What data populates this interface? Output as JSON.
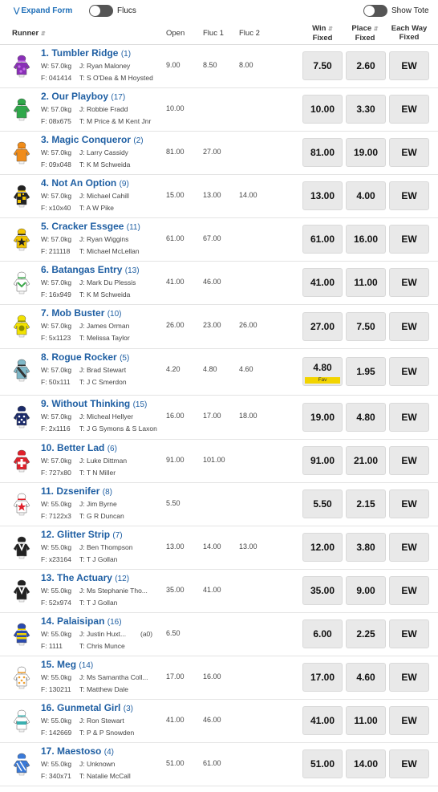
{
  "topbar": {
    "expand_label": "Expand Form",
    "flucs_label": "Flucs",
    "tote_label": "Show Tote"
  },
  "header": {
    "runner": "Runner",
    "open": "Open",
    "fluc1": "Fluc 1",
    "fluc2": "Fluc 2",
    "win": [
      "Win",
      "Fixed"
    ],
    "place": [
      "Place",
      "Fixed"
    ],
    "ew": [
      "Each Way",
      "Fixed"
    ]
  },
  "runners": [
    {
      "num": "1.",
      "name": "Tumbler Ridge",
      "barrier": "(1)",
      "weight": "W: 57.0kg",
      "jockey": "J: Ryan Maloney",
      "extra": "",
      "form": "F: 041414",
      "trainer": "T: S O'Dea & M Hoysted",
      "open": "9.00",
      "fluc1": "8.50",
      "fluc2": "8.00",
      "win": "7.50",
      "place": "2.60",
      "ew": "EW",
      "fav": "",
      "silk": {
        "a": "#8a2fb8",
        "b": "#c56ee8",
        "pattern": "stars"
      }
    },
    {
      "num": "2.",
      "name": "Our Playboy",
      "barrier": "(17)",
      "weight": "W: 57.0kg",
      "jockey": "J: Robbie Fradd",
      "extra": "",
      "form": "F: 08x675",
      "trainer": "T: M Price & M Kent Jnr",
      "open": "10.00",
      "fluc1": "",
      "fluc2": "",
      "win": "10.00",
      "place": "3.30",
      "ew": "EW",
      "fav": "",
      "silk": {
        "a": "#2fa84a",
        "b": "#1f7a33",
        "pattern": "plain"
      }
    },
    {
      "num": "3.",
      "name": "Magic Conqueror",
      "barrier": "(2)",
      "weight": "W: 57.0kg",
      "jockey": "J: Larry Cassidy",
      "extra": "",
      "form": "F: 09x048",
      "trainer": "T: K M Schweida",
      "open": "81.00",
      "fluc1": "27.00",
      "fluc2": "",
      "win": "81.00",
      "place": "19.00",
      "ew": "EW",
      "fav": "",
      "silk": {
        "a": "#f08c1a",
        "b": "#d86f00",
        "pattern": "plain"
      }
    },
    {
      "num": "4.",
      "name": "Not An Option",
      "barrier": "(9)",
      "weight": "W: 57.0kg",
      "jockey": "J: Michael Cahill",
      "extra": "",
      "form": "F: x10x40",
      "trainer": "T: A W Pike",
      "open": "15.00",
      "fluc1": "13.00",
      "fluc2": "14.00",
      "win": "13.00",
      "place": "4.00",
      "ew": "EW",
      "fav": "",
      "silk": {
        "a": "#222222",
        "b": "#f2c400",
        "pattern": "checks"
      }
    },
    {
      "num": "5.",
      "name": "Cracker Essgee",
      "barrier": "(11)",
      "weight": "W: 57.0kg",
      "jockey": "J: Ryan Wiggins",
      "extra": "",
      "form": "F: 211118",
      "trainer": "T: Michael McLellan",
      "open": "61.00",
      "fluc1": "67.00",
      "fluc2": "",
      "win": "61.00",
      "place": "16.00",
      "ew": "EW",
      "fav": "",
      "silk": {
        "a": "#f2c400",
        "b": "#222222",
        "pattern": "star"
      }
    },
    {
      "num": "6.",
      "name": "Batangas Entry",
      "barrier": "(13)",
      "weight": "W: 57.0kg",
      "jockey": "J: Mark Du Plessis",
      "extra": "",
      "form": "F: 16x949",
      "trainer": "T: K M Schweida",
      "open": "41.00",
      "fluc1": "46.00",
      "fluc2": "",
      "win": "41.00",
      "place": "11.00",
      "ew": "EW",
      "fav": "",
      "silk": {
        "a": "#ffffff",
        "b": "#3aa84a",
        "pattern": "chevron"
      }
    },
    {
      "num": "7.",
      "name": "Mob Buster",
      "barrier": "(10)",
      "weight": "W: 57.0kg",
      "jockey": "J: James Orman",
      "extra": "",
      "form": "F: 5x1123",
      "trainer": "T: Melissa Taylor",
      "open": "26.00",
      "fluc1": "23.00",
      "fluc2": "26.00",
      "win": "27.00",
      "place": "7.50",
      "ew": "EW",
      "fav": "",
      "silk": {
        "a": "#f2e200",
        "b": "#8a8a00",
        "pattern": "disc"
      }
    },
    {
      "num": "8.",
      "name": "Rogue Rocker",
      "barrier": "(5)",
      "weight": "W: 57.0kg",
      "jockey": "J: Brad Stewart",
      "extra": "",
      "form": "F: 50x111",
      "trainer": "T: J C Smerdon",
      "open": "4.20",
      "fluc1": "4.80",
      "fluc2": "4.60",
      "win": "4.80",
      "place": "1.95",
      "ew": "EW",
      "fav": "Fav",
      "silk": {
        "a": "#7fb8c8",
        "b": "#333333",
        "pattern": "sash"
      }
    },
    {
      "num": "9.",
      "name": "Without Thinking",
      "barrier": "(15)",
      "weight": "W: 57.0kg",
      "jockey": "J: Micheal Hellyer",
      "extra": "",
      "form": "F: 2x1116",
      "trainer": "T: J G Symons & S Laxon",
      "open": "16.00",
      "fluc1": "17.00",
      "fluc2": "18.00",
      "win": "19.00",
      "place": "4.80",
      "ew": "EW",
      "fav": "",
      "silk": {
        "a": "#1a2a6a",
        "b": "#ffffff",
        "pattern": "spots"
      }
    },
    {
      "num": "10.",
      "name": "Better Lad",
      "barrier": "(6)",
      "weight": "W: 57.0kg",
      "jockey": "J: Luke Dittman",
      "extra": "",
      "form": "F: 727x80",
      "trainer": "T: T N Miller",
      "open": "91.00",
      "fluc1": "101.00",
      "fluc2": "",
      "win": "91.00",
      "place": "21.00",
      "ew": "EW",
      "fav": "",
      "silk": {
        "a": "#e0202a",
        "b": "#ffffff",
        "pattern": "cross"
      }
    },
    {
      "num": "11.",
      "name": "Dzsenifer",
      "barrier": "(8)",
      "weight": "W: 55.0kg",
      "jockey": "J: Jim Byrne",
      "extra": "",
      "form": "F: 7122x3",
      "trainer": "T: G R Duncan",
      "open": "5.50",
      "fluc1": "",
      "fluc2": "",
      "win": "5.50",
      "place": "2.15",
      "ew": "EW",
      "fav": "",
      "silk": {
        "a": "#ffffff",
        "b": "#e0202a",
        "pattern": "star"
      }
    },
    {
      "num": "12.",
      "name": "Glitter Strip",
      "barrier": "(7)",
      "weight": "W: 55.0kg",
      "jockey": "J: Ben Thompson",
      "extra": "",
      "form": "F: x23164",
      "trainer": "T: T J Gollan",
      "open": "13.00",
      "fluc1": "14.00",
      "fluc2": "13.00",
      "win": "12.00",
      "place": "3.80",
      "ew": "EW",
      "fav": "",
      "silk": {
        "a": "#222222",
        "b": "#ffffff",
        "pattern": "vee"
      }
    },
    {
      "num": "13.",
      "name": "The Actuary",
      "barrier": "(12)",
      "weight": "W: 55.0kg",
      "jockey": "J: Ms Stephanie Tho...",
      "extra": "",
      "form": "F: 52x974",
      "trainer": "T: T J Gollan",
      "open": "35.00",
      "fluc1": "41.00",
      "fluc2": "",
      "win": "35.00",
      "place": "9.00",
      "ew": "EW",
      "fav": "",
      "silk": {
        "a": "#222222",
        "b": "#ffffff",
        "pattern": "vee"
      }
    },
    {
      "num": "14.",
      "name": "Palaisipan",
      "barrier": "(16)",
      "weight": "W: 55.0kg",
      "jockey": "J: Justin Huxt...",
      "extra": "(a0)",
      "form": "F: 1111",
      "trainer": "T: Chris Munce",
      "open": "6.50",
      "fluc1": "",
      "fluc2": "",
      "win": "6.00",
      "place": "2.25",
      "ew": "EW",
      "fav": "",
      "silk": {
        "a": "#2a4ab0",
        "b": "#f2d400",
        "pattern": "hoops"
      }
    },
    {
      "num": "15.",
      "name": "Meg",
      "barrier": "(14)",
      "weight": "W: 55.0kg",
      "jockey": "J: Ms Samantha Coll...",
      "extra": "",
      "form": "F: 130211",
      "trainer": "T: Matthew Dale",
      "open": "17.00",
      "fluc1": "16.00",
      "fluc2": "",
      "win": "17.00",
      "place": "4.60",
      "ew": "EW",
      "fav": "",
      "silk": {
        "a": "#ffffff",
        "b": "#f0a030",
        "pattern": "spots"
      }
    },
    {
      "num": "16.",
      "name": "Gunmetal Girl",
      "barrier": "(3)",
      "weight": "W: 55.0kg",
      "jockey": "J: Ron Stewart",
      "extra": "",
      "form": "F: 142669",
      "trainer": "T: P & P Snowden",
      "open": "41.00",
      "fluc1": "46.00",
      "fluc2": "",
      "win": "41.00",
      "place": "11.00",
      "ew": "EW",
      "fav": "",
      "silk": {
        "a": "#ffffff",
        "b": "#3ab0b0",
        "pattern": "band"
      }
    },
    {
      "num": "17.",
      "name": "Maestoso",
      "barrier": "(4)",
      "weight": "W: 55.0kg",
      "jockey": "J: Unknown",
      "extra": "",
      "form": "F: 340x71",
      "trainer": "T: Natalie McCall",
      "open": "51.00",
      "fluc1": "61.00",
      "fluc2": "",
      "win": "51.00",
      "place": "14.00",
      "ew": "EW",
      "fav": "",
      "silk": {
        "a": "#3a7ad8",
        "b": "#ffffff",
        "pattern": "diag"
      }
    }
  ]
}
